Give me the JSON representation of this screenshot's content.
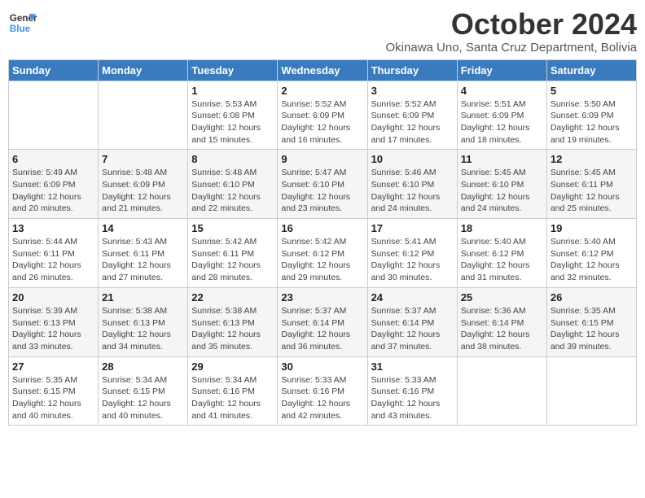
{
  "logo": {
    "line1": "General",
    "line2": "Blue"
  },
  "title": "October 2024",
  "subtitle": "Okinawa Uno, Santa Cruz Department, Bolivia",
  "days_of_week": [
    "Sunday",
    "Monday",
    "Tuesday",
    "Wednesday",
    "Thursday",
    "Friday",
    "Saturday"
  ],
  "weeks": [
    [
      {
        "day": "",
        "info": ""
      },
      {
        "day": "",
        "info": ""
      },
      {
        "day": "1",
        "sunrise": "5:53 AM",
        "sunset": "6:08 PM",
        "daylight": "12 hours and 15 minutes."
      },
      {
        "day": "2",
        "sunrise": "5:52 AM",
        "sunset": "6:09 PM",
        "daylight": "12 hours and 16 minutes."
      },
      {
        "day": "3",
        "sunrise": "5:52 AM",
        "sunset": "6:09 PM",
        "daylight": "12 hours and 17 minutes."
      },
      {
        "day": "4",
        "sunrise": "5:51 AM",
        "sunset": "6:09 PM",
        "daylight": "12 hours and 18 minutes."
      },
      {
        "day": "5",
        "sunrise": "5:50 AM",
        "sunset": "6:09 PM",
        "daylight": "12 hours and 19 minutes."
      }
    ],
    [
      {
        "day": "6",
        "sunrise": "5:49 AM",
        "sunset": "6:09 PM",
        "daylight": "12 hours and 20 minutes."
      },
      {
        "day": "7",
        "sunrise": "5:48 AM",
        "sunset": "6:09 PM",
        "daylight": "12 hours and 21 minutes."
      },
      {
        "day": "8",
        "sunrise": "5:48 AM",
        "sunset": "6:10 PM",
        "daylight": "12 hours and 22 minutes."
      },
      {
        "day": "9",
        "sunrise": "5:47 AM",
        "sunset": "6:10 PM",
        "daylight": "12 hours and 23 minutes."
      },
      {
        "day": "10",
        "sunrise": "5:46 AM",
        "sunset": "6:10 PM",
        "daylight": "12 hours and 24 minutes."
      },
      {
        "day": "11",
        "sunrise": "5:45 AM",
        "sunset": "6:10 PM",
        "daylight": "12 hours and 24 minutes."
      },
      {
        "day": "12",
        "sunrise": "5:45 AM",
        "sunset": "6:11 PM",
        "daylight": "12 hours and 25 minutes."
      }
    ],
    [
      {
        "day": "13",
        "sunrise": "5:44 AM",
        "sunset": "6:11 PM",
        "daylight": "12 hours and 26 minutes."
      },
      {
        "day": "14",
        "sunrise": "5:43 AM",
        "sunset": "6:11 PM",
        "daylight": "12 hours and 27 minutes."
      },
      {
        "day": "15",
        "sunrise": "5:42 AM",
        "sunset": "6:11 PM",
        "daylight": "12 hours and 28 minutes."
      },
      {
        "day": "16",
        "sunrise": "5:42 AM",
        "sunset": "6:12 PM",
        "daylight": "12 hours and 29 minutes."
      },
      {
        "day": "17",
        "sunrise": "5:41 AM",
        "sunset": "6:12 PM",
        "daylight": "12 hours and 30 minutes."
      },
      {
        "day": "18",
        "sunrise": "5:40 AM",
        "sunset": "6:12 PM",
        "daylight": "12 hours and 31 minutes."
      },
      {
        "day": "19",
        "sunrise": "5:40 AM",
        "sunset": "6:12 PM",
        "daylight": "12 hours and 32 minutes."
      }
    ],
    [
      {
        "day": "20",
        "sunrise": "5:39 AM",
        "sunset": "6:13 PM",
        "daylight": "12 hours and 33 minutes."
      },
      {
        "day": "21",
        "sunrise": "5:38 AM",
        "sunset": "6:13 PM",
        "daylight": "12 hours and 34 minutes."
      },
      {
        "day": "22",
        "sunrise": "5:38 AM",
        "sunset": "6:13 PM",
        "daylight": "12 hours and 35 minutes."
      },
      {
        "day": "23",
        "sunrise": "5:37 AM",
        "sunset": "6:14 PM",
        "daylight": "12 hours and 36 minutes."
      },
      {
        "day": "24",
        "sunrise": "5:37 AM",
        "sunset": "6:14 PM",
        "daylight": "12 hours and 37 minutes."
      },
      {
        "day": "25",
        "sunrise": "5:36 AM",
        "sunset": "6:14 PM",
        "daylight": "12 hours and 38 minutes."
      },
      {
        "day": "26",
        "sunrise": "5:35 AM",
        "sunset": "6:15 PM",
        "daylight": "12 hours and 39 minutes."
      }
    ],
    [
      {
        "day": "27",
        "sunrise": "5:35 AM",
        "sunset": "6:15 PM",
        "daylight": "12 hours and 40 minutes."
      },
      {
        "day": "28",
        "sunrise": "5:34 AM",
        "sunset": "6:15 PM",
        "daylight": "12 hours and 40 minutes."
      },
      {
        "day": "29",
        "sunrise": "5:34 AM",
        "sunset": "6:16 PM",
        "daylight": "12 hours and 41 minutes."
      },
      {
        "day": "30",
        "sunrise": "5:33 AM",
        "sunset": "6:16 PM",
        "daylight": "12 hours and 42 minutes."
      },
      {
        "day": "31",
        "sunrise": "5:33 AM",
        "sunset": "6:16 PM",
        "daylight": "12 hours and 43 minutes."
      },
      {
        "day": "",
        "info": ""
      },
      {
        "day": "",
        "info": ""
      }
    ]
  ],
  "labels": {
    "sunrise_prefix": "Sunrise: ",
    "sunset_prefix": "Sunset: ",
    "daylight_prefix": "Daylight: "
  }
}
